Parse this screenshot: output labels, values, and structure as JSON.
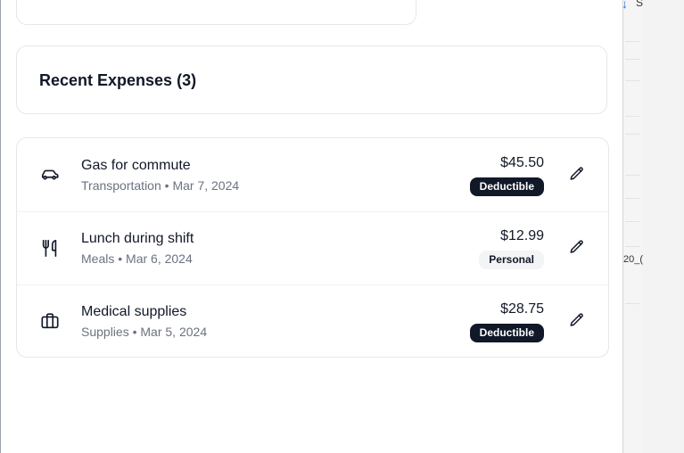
{
  "header": {
    "title": "Recent Expenses (3)"
  },
  "expenses": [
    {
      "name": "Gas for commute",
      "category": "Transportation",
      "date": "Mar 7, 2024",
      "amount": "$45.50",
      "badge": "Deductible",
      "icon": "car-icon"
    },
    {
      "name": "Lunch during shift",
      "category": "Meals",
      "date": "Mar 6, 2024",
      "amount": "$12.99",
      "badge": "Personal",
      "icon": "utensils-icon"
    },
    {
      "name": "Medical supplies",
      "category": "Supplies",
      "date": "Mar 5, 2024",
      "amount": "$28.75",
      "badge": "Deductible",
      "icon": "briefcase-icon"
    }
  ],
  "meta_separator": "•",
  "background_window": {
    "fragment_1": "S",
    "fragment_2": "20_("
  },
  "colors": {
    "badge_dark": "#111827",
    "badge_light": "#f3f4f6",
    "border": "#e5e7eb",
    "muted_text": "#6b7280"
  }
}
